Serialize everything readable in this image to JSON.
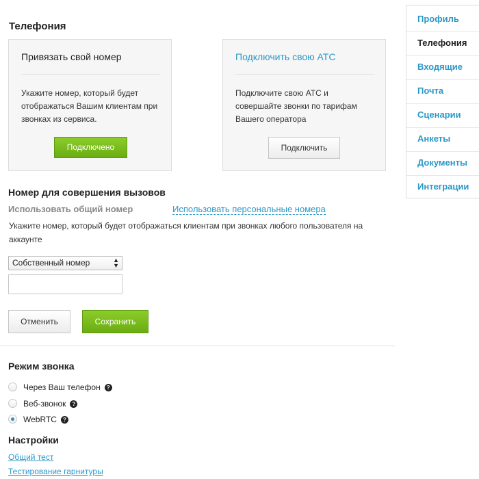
{
  "page": {
    "title": "Телефония"
  },
  "cards": {
    "own_number": {
      "title": "Привязать свой номер",
      "description": "Укажите номер, который будет отображаться Вашим клиентам при звонках из сервиса.",
      "button": "Подключено"
    },
    "own_pbx": {
      "title": "Подключить свою АТС",
      "description": "Подключите свою АТС и совершайте звонки по тарифам Вашего оператора",
      "button": "Подключить"
    }
  },
  "calling_number": {
    "heading": "Номер для совершения вызовов",
    "mode_common": "Использовать общий номер",
    "mode_personal": "Использовать персональные номера",
    "description": "Укажите номер, который будет отображаться клиентам при звонках любого пользователя на аккаунте",
    "select_value": "Собственный номер",
    "input_value": "",
    "cancel_label": "Отменить",
    "save_label": "Сохранить"
  },
  "call_mode": {
    "heading": "Режим звонка",
    "options": [
      {
        "label": "Через Ваш телефон",
        "selected": false
      },
      {
        "label": "Веб-звонок",
        "selected": false
      },
      {
        "label": "WebRTC",
        "selected": true
      }
    ]
  },
  "settings": {
    "heading": "Настройки",
    "links": [
      "Общий тест",
      "Тестирование гарнитуры"
    ]
  },
  "sidebar": {
    "items": [
      {
        "label": "Профиль",
        "active": false
      },
      {
        "label": "Телефония",
        "active": true
      },
      {
        "label": "Входящие",
        "active": false
      },
      {
        "label": "Почта",
        "active": false
      },
      {
        "label": "Сценарии",
        "active": false
      },
      {
        "label": "Анкеты",
        "active": false
      },
      {
        "label": "Документы",
        "active": false
      },
      {
        "label": "Интеграции",
        "active": false
      }
    ]
  },
  "colors": {
    "accent_link": "#2a98c8",
    "button_green": "#7cbd1e",
    "card_bg": "#f6f6f6"
  },
  "icons": {
    "help": "question-circle-icon",
    "select_arrows": "updown-arrows-icon"
  }
}
